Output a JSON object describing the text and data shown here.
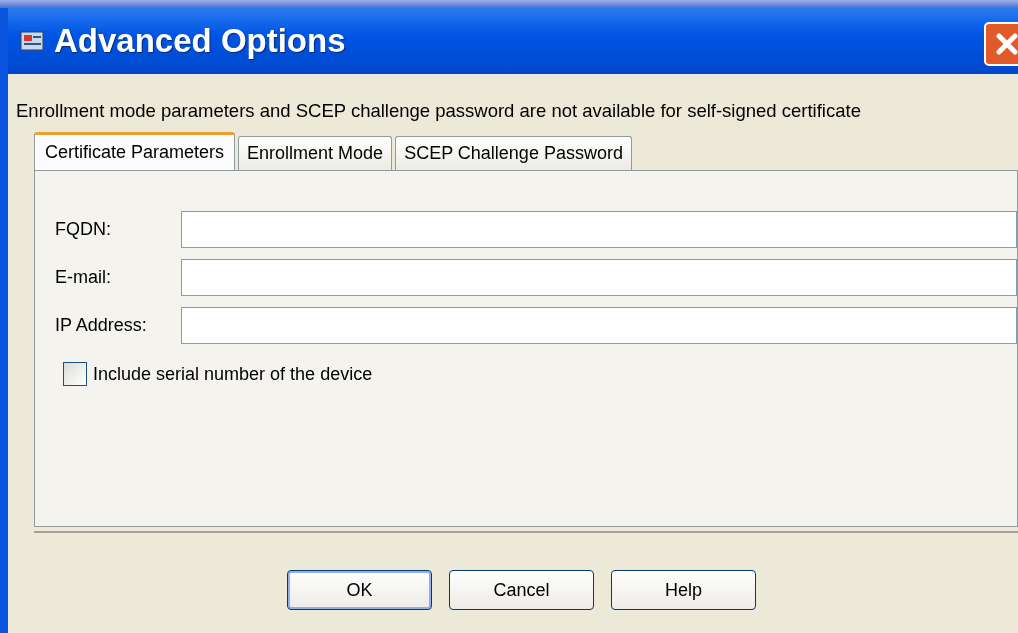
{
  "window": {
    "title": "Advanced Options"
  },
  "message": "Enrollment mode parameters and SCEP challenge password are not available for self-signed certificate",
  "tabs": [
    {
      "label": "Certificate Parameters",
      "selected": true
    },
    {
      "label": "Enrollment Mode",
      "selected": false
    },
    {
      "label": "SCEP Challenge Password",
      "selected": false
    }
  ],
  "fields": [
    {
      "label": "FQDN:"
    },
    {
      "label": "E-mail:"
    },
    {
      "label": "IP Address:"
    }
  ],
  "checkbox": {
    "label": "Include serial number of the device",
    "checked": false
  },
  "buttons": [
    {
      "label": "OK",
      "default": true
    },
    {
      "label": "Cancel",
      "default": false
    },
    {
      "label": "Help",
      "default": false
    }
  ]
}
